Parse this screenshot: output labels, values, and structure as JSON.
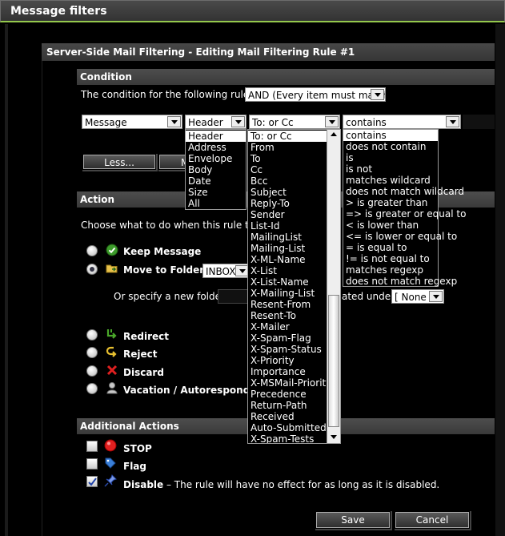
{
  "window": {
    "title": "Message filters"
  },
  "panel": {
    "title": "Server-Side Mail Filtering - Editing Mail Filtering Rule #1"
  },
  "condition": {
    "heading": "Condition",
    "rules_label": "The condition for the following rules is:",
    "rules_value": "AND (Every item must match)",
    "field1": "Message",
    "field2": "Header",
    "field3": "To: or Cc",
    "field4": "contains",
    "less_label": "Less...",
    "more_label_partial": "M"
  },
  "dropdown_header": {
    "items": [
      "Header",
      "Address",
      "Envelope",
      "Body",
      "Date",
      "Size",
      "All"
    ],
    "selected_index": 0
  },
  "dropdown_fields": {
    "items": [
      "To: or Cc",
      "From",
      "To",
      "Cc",
      "Bcc",
      "Subject",
      "Reply-To",
      "Sender",
      "List-Id",
      "MailingList",
      "Mailing-List",
      "X-ML-Name",
      "X-List",
      "X-List-Name",
      "X-Mailing-List",
      "Resent-From",
      "Resent-To",
      "X-Mailer",
      "X-Spam-Flag",
      "X-Spam-Status",
      "X-Priority",
      "Importance",
      "X-MSMail-Priority",
      "Precedence",
      "Return-Path",
      "Received",
      "Auto-Submitted",
      "X-Spam-Tests"
    ],
    "selected_index": 0
  },
  "dropdown_ops": {
    "items": [
      "contains",
      "does not contain",
      "is",
      "is not",
      "matches wildcard",
      "does not match wildcard",
      "> is greater than",
      "=> is greater or equal to",
      "< is lower than",
      "<= is lower or equal to",
      "= is equal to",
      "!= is not equal to",
      "matches regexp",
      "does not match regexp"
    ],
    "selected_index": 0
  },
  "action": {
    "heading": "Action",
    "intro_partial": "Choose what to do when this rule trigg",
    "keep": "Keep Message",
    "move": "Move to Folder",
    "move_dash": "–",
    "folder_value": "INBOX",
    "new_folder_label": "Or specify a new folder:",
    "created_under_partial": "ated under",
    "parent_value": "[ None ]",
    "redirect": "Redirect",
    "reject": "Reject",
    "discard": "Discard",
    "vacation": "Vacation / Autoresponder",
    "selected": "move"
  },
  "additional": {
    "heading": "Additional Actions",
    "stop": "STOP",
    "flag": "Flag",
    "disable": "Disable",
    "disable_desc": "– The rule will have no effect for as long as it is disabled.",
    "stop_checked": false,
    "flag_checked": false,
    "disable_checked": true
  },
  "footer": {
    "save": "Save",
    "cancel": "Cancel"
  },
  "colors": {
    "accent": "#94c84c",
    "selection": "#ffffff"
  }
}
